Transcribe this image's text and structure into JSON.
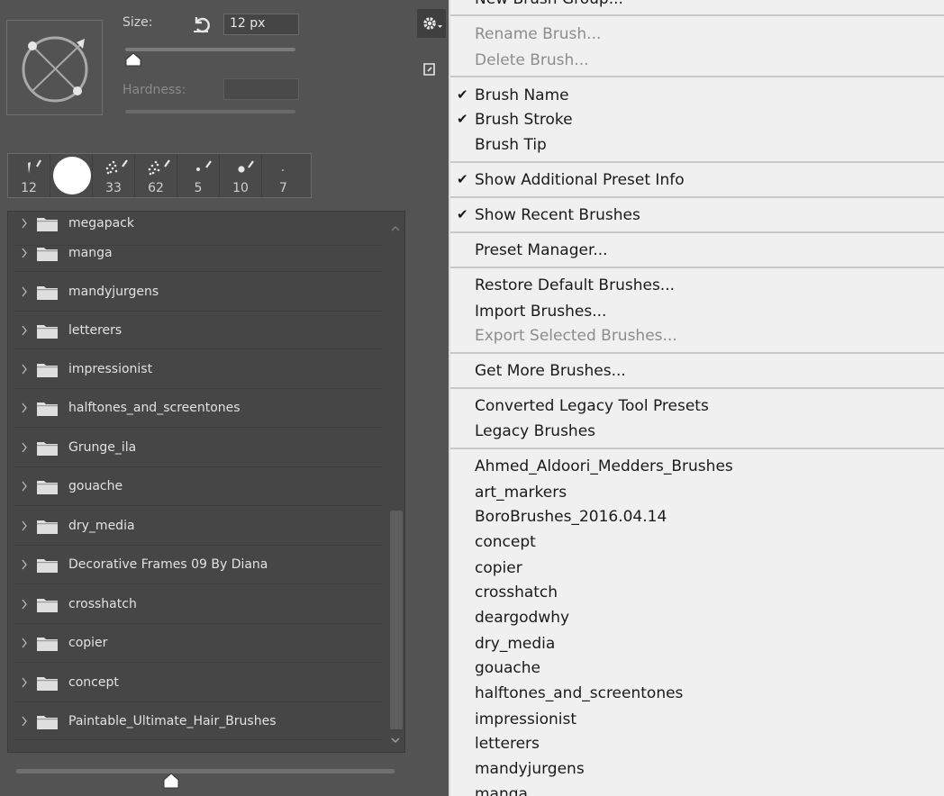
{
  "panel": {
    "size_label": "Size:",
    "size_value": "12 px",
    "size_level": 0.05,
    "hardness_label": "Hardness:",
    "hardness_value": "",
    "hardness_level": 0,
    "recent_brushes": [
      "12",
      "",
      "33",
      "62",
      "5",
      "10",
      "7"
    ],
    "brush_groups": [
      "megapack",
      "manga",
      "mandyjurgens",
      "letterers",
      "impressionist",
      "halftones_and_screentones",
      "Grunge_ila",
      "gouache",
      "dry_media",
      "Decorative Frames 09 By Diana",
      "crosshatch",
      "copier",
      "concept",
      "Paintable_Ultimate_Hair_Brushes"
    ],
    "preview_size_level": 0.41
  },
  "menu": {
    "partial_top": "New Brush Group...",
    "rename": "Rename Brush...",
    "delete": "Delete Brush...",
    "brush_name": "Brush Name",
    "brush_stroke": "Brush Stroke",
    "brush_tip": "Brush Tip",
    "show_additional": "Show Additional Preset Info",
    "show_recent": "Show Recent Brushes",
    "preset_manager": "Preset Manager...",
    "restore_default": "Restore Default Brushes...",
    "import": "Import Brushes...",
    "export_selected": "Export Selected Brushes...",
    "get_more": "Get More Brushes...",
    "converted_legacy": "Converted Legacy Tool Presets",
    "legacy": "Legacy Brushes",
    "library": [
      "Ahmed_Aldoori_Medders_Brushes",
      "art_markers",
      "BoroBrushes_2016.04.14",
      "concept",
      "copier",
      "crosshatch",
      "deargodwhy",
      "dry_media",
      "gouache",
      "halftones_and_screentones",
      "impressionist",
      "letterers",
      "mandyjurgens",
      "manga"
    ],
    "checkmark": "✔"
  }
}
